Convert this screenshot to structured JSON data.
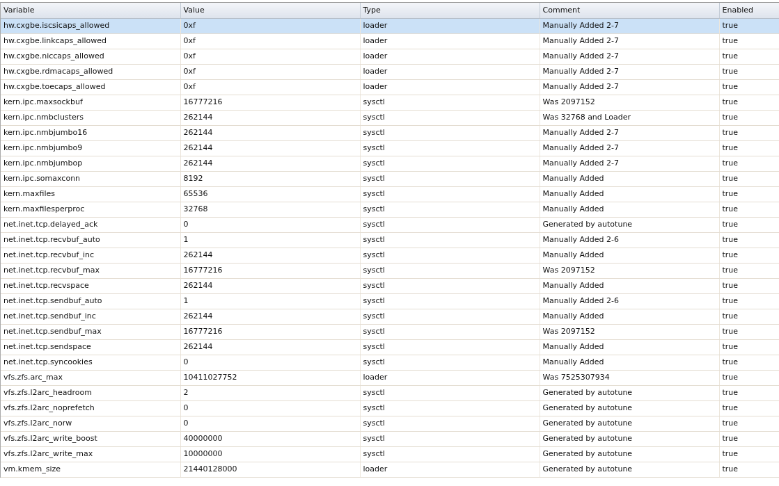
{
  "table": {
    "columns": [
      "Variable",
      "Value",
      "Type",
      "Comment",
      "Enabled"
    ],
    "rows": [
      {
        "selected": true,
        "cells": [
          "hw.cxgbe.iscsicaps_allowed",
          "0xf",
          "loader",
          "Manually Added 2-7",
          "true"
        ]
      },
      {
        "selected": false,
        "cells": [
          "hw.cxgbe.linkcaps_allowed",
          "0xf",
          "loader",
          "Manually Added 2-7",
          "true"
        ]
      },
      {
        "selected": false,
        "cells": [
          "hw.cxgbe.niccaps_allowed",
          "0xf",
          "loader",
          "Manually Added 2-7",
          "true"
        ]
      },
      {
        "selected": false,
        "cells": [
          "hw.cxgbe.rdmacaps_allowed",
          "0xf",
          "loader",
          "Manually Added 2-7",
          "true"
        ]
      },
      {
        "selected": false,
        "cells": [
          "hw.cxgbe.toecaps_allowed",
          "0xf",
          "loader",
          "Manually Added 2-7",
          "true"
        ]
      },
      {
        "selected": false,
        "cells": [
          "kern.ipc.maxsockbuf",
          "16777216",
          "sysctl",
          "Was 2097152",
          "true"
        ]
      },
      {
        "selected": false,
        "cells": [
          "kern.ipc.nmbclusters",
          "262144",
          "sysctl",
          "Was 32768 and Loader",
          "true"
        ]
      },
      {
        "selected": false,
        "cells": [
          "kern.ipc.nmbjumbo16",
          "262144",
          "sysctl",
          "Manually Added 2-7",
          "true"
        ]
      },
      {
        "selected": false,
        "cells": [
          "kern.ipc.nmbjumbo9",
          "262144",
          "sysctl",
          "Manually Added 2-7",
          "true"
        ]
      },
      {
        "selected": false,
        "cells": [
          "kern.ipc.nmbjumbop",
          "262144",
          "sysctl",
          "Manually Added 2-7",
          "true"
        ]
      },
      {
        "selected": false,
        "cells": [
          "kern.ipc.somaxconn",
          "8192",
          "sysctl",
          "Manually Added",
          "true"
        ]
      },
      {
        "selected": false,
        "cells": [
          "kern.maxfiles",
          "65536",
          "sysctl",
          "Manually Added",
          "true"
        ]
      },
      {
        "selected": false,
        "cells": [
          "kern.maxfilesperproc",
          "32768",
          "sysctl",
          "Manually Added",
          "true"
        ]
      },
      {
        "selected": false,
        "cells": [
          "net.inet.tcp.delayed_ack",
          "0",
          "sysctl",
          "Generated by autotune",
          "true"
        ]
      },
      {
        "selected": false,
        "cells": [
          "net.inet.tcp.recvbuf_auto",
          "1",
          "sysctl",
          "Manually Added 2-6",
          "true"
        ]
      },
      {
        "selected": false,
        "cells": [
          "net.inet.tcp.recvbuf_inc",
          "262144",
          "sysctl",
          "Manually Added",
          "true"
        ]
      },
      {
        "selected": false,
        "cells": [
          "net.inet.tcp.recvbuf_max",
          "16777216",
          "sysctl",
          "Was 2097152",
          "true"
        ]
      },
      {
        "selected": false,
        "cells": [
          "net.inet.tcp.recvspace",
          "262144",
          "sysctl",
          "Manually Added",
          "true"
        ]
      },
      {
        "selected": false,
        "cells": [
          "net.inet.tcp.sendbuf_auto",
          "1",
          "sysctl",
          "Manually Added 2-6",
          "true"
        ]
      },
      {
        "selected": false,
        "cells": [
          "net.inet.tcp.sendbuf_inc",
          "262144",
          "sysctl",
          "Manually Added",
          "true"
        ]
      },
      {
        "selected": false,
        "cells": [
          "net.inet.tcp.sendbuf_max",
          "16777216",
          "sysctl",
          "Was 2097152",
          "true"
        ]
      },
      {
        "selected": false,
        "cells": [
          "net.inet.tcp.sendspace",
          "262144",
          "sysctl",
          "Manually Added",
          "true"
        ]
      },
      {
        "selected": false,
        "cells": [
          "net.inet.tcp.syncookies",
          "0",
          "sysctl",
          "Manually Added",
          "true"
        ]
      },
      {
        "selected": false,
        "cells": [
          "vfs.zfs.arc_max",
          "10411027752",
          "loader",
          "Was 7525307934",
          "true"
        ]
      },
      {
        "selected": false,
        "cells": [
          "vfs.zfs.l2arc_headroom",
          "2",
          "sysctl",
          "Generated by autotune",
          "true"
        ]
      },
      {
        "selected": false,
        "cells": [
          "vfs.zfs.l2arc_noprefetch",
          "0",
          "sysctl",
          "Generated by autotune",
          "true"
        ]
      },
      {
        "selected": false,
        "cells": [
          "vfs.zfs.l2arc_norw",
          "0",
          "sysctl",
          "Generated by autotune",
          "true"
        ]
      },
      {
        "selected": false,
        "cells": [
          "vfs.zfs.l2arc_write_boost",
          "40000000",
          "sysctl",
          "Generated by autotune",
          "true"
        ]
      },
      {
        "selected": false,
        "cells": [
          "vfs.zfs.l2arc_write_max",
          "10000000",
          "sysctl",
          "Generated by autotune",
          "true"
        ]
      },
      {
        "selected": false,
        "cells": [
          "vm.kmem_size",
          "21440128000",
          "loader",
          "Generated by autotune",
          "true"
        ]
      }
    ]
  }
}
